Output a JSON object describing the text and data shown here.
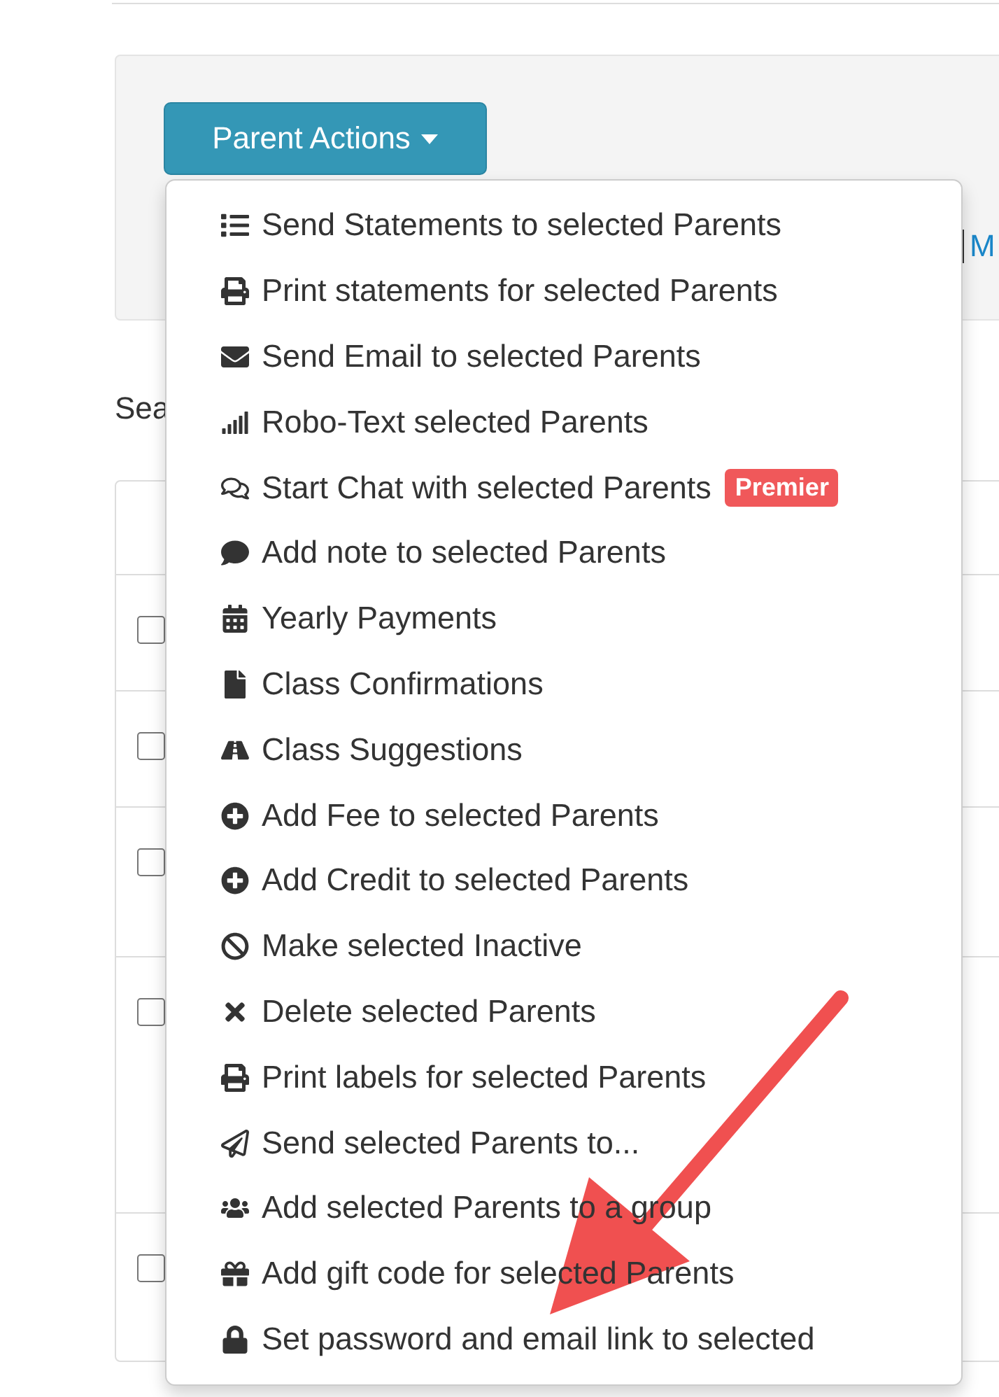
{
  "toolbar": {
    "button": {
      "label": "Parent Actions"
    },
    "link": "M"
  },
  "search_label": "Sea",
  "table": {
    "rows": [
      {
        "checked": false
      },
      {
        "checked": false
      },
      {
        "checked": false
      },
      {
        "checked": false
      },
      {
        "checked": false
      }
    ]
  },
  "menu": {
    "items": [
      {
        "label": "Send Statements to selected Parents"
      },
      {
        "label": "Print statements for selected Parents"
      },
      {
        "label": "Send Email to selected Parents"
      },
      {
        "label": "Robo-Text selected Parents"
      },
      {
        "label": "Start Chat with selected Parents",
        "badge": "Premier"
      },
      {
        "label": "Add note to selected Parents"
      },
      {
        "label": "Yearly Payments"
      },
      {
        "label": "Class Confirmations"
      },
      {
        "label": "Class Suggestions"
      },
      {
        "label": "Add Fee to selected Parents"
      },
      {
        "label": "Add Credit to selected Parents"
      },
      {
        "label": "Make selected Inactive"
      },
      {
        "label": "Delete selected Parents"
      },
      {
        "label": "Print labels for selected Parents"
      },
      {
        "label": "Send selected Parents to..."
      },
      {
        "label": "Add selected Parents to a group"
      },
      {
        "label": "Add gift code for selected Parents"
      },
      {
        "label": "Set password and email link to selected"
      }
    ]
  }
}
